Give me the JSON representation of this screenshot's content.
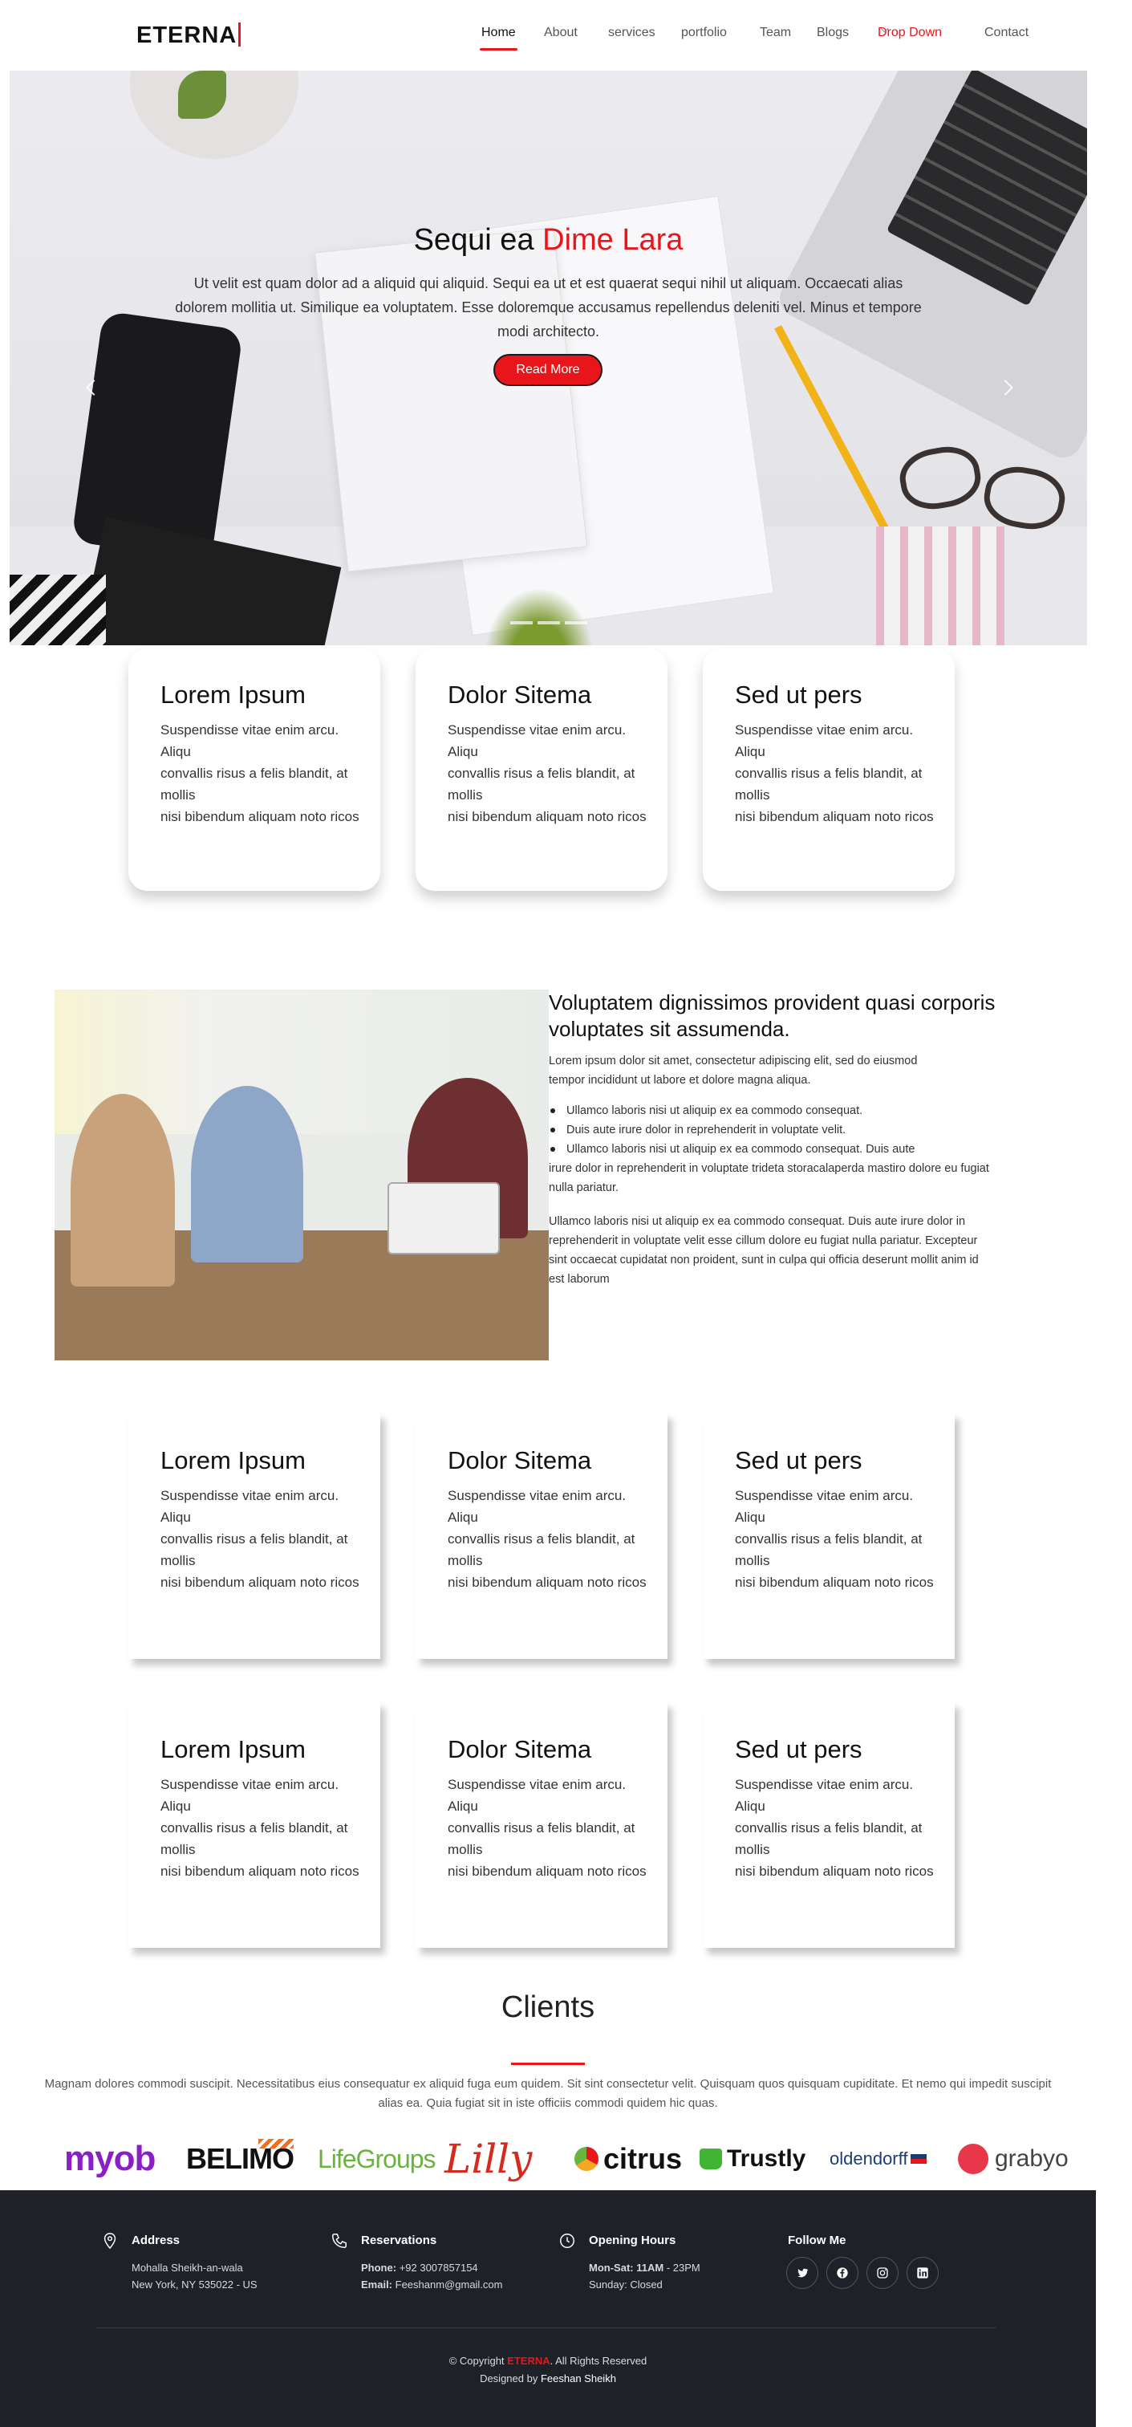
{
  "brand": {
    "name": "ETERNA"
  },
  "nav": {
    "items": [
      "Home",
      "About",
      "services",
      "portfolio",
      "Team",
      "Blogs",
      "Drop Down",
      "Contact"
    ],
    "active": "Home"
  },
  "hero": {
    "title_main": "Sequi ea",
    "title_accent": "Dime Lara",
    "text": "Ut velit est quam dolor ad a aliquid qui aliquid. Sequi ea ut et est quaerat sequi nihil ut aliquam. Occaecati alias dolorem mollitia ut. Similique ea voluptatem. Esse doloremque accusamus repellendus deleniti vel. Minus et tempore modi architecto.",
    "button": "Read More"
  },
  "cards_top": [
    {
      "title": "Lorem Ipsum",
      "line1": "Suspendisse vitae enim arcu. Aliqu",
      "line2": "convallis risus a felis blandit, at mollis",
      "line3": "nisi bibendum aliquam noto ricos"
    },
    {
      "title": "Dolor Sitema",
      "line1": "Suspendisse vitae enim arcu. Aliqu",
      "line2": "convallis risus a felis blandit, at mollis",
      "line3": "nisi bibendum aliquam noto ricos"
    },
    {
      "title": "Sed ut pers",
      "line1": "Suspendisse vitae enim arcu. Aliqu",
      "line2": "convallis risus a felis blandit, at mollis",
      "line3": "nisi bibendum aliquam noto ricos"
    }
  ],
  "about": {
    "title": "Voluptatem dignissimos provident quasi corporis voluptates sit assumenda.",
    "intro_1": "Lorem ipsum dolor sit amet, consectetur adipiscing elit, sed do eiusmod",
    "intro_2": "tempor incididunt ut labore et dolore magna aliqua.",
    "bullet_1": "Ullamco laboris nisi ut aliquip ex ea commodo consequat.",
    "bullet_2": "Duis aute irure dolor in reprehenderit in voluptate velit.",
    "bullet_3": "Ullamco laboris nisi ut aliquip ex ea commodo consequat. Duis aute",
    "bullet_3b": "irure dolor in reprehenderit in voluptate trideta storacalaperda mastiro dolore eu fugiat",
    "bullet_3c": "nulla pariatur.",
    "outro_1": "Ullamco laboris nisi ut aliquip ex ea commodo consequat. Duis aute irure dolor in",
    "outro_2": "reprehenderit in voluptate velit esse cillum dolore eu fugiat nulla pariatur. Excepteur",
    "outro_3": "sint occaecat cupidatat non proident, sunt in culpa qui officia deserunt mollit anim id",
    "outro_4": "est laborum"
  },
  "cards_grid": [
    {
      "title": "Lorem Ipsum",
      "line1": "Suspendisse vitae enim arcu. Aliqu",
      "line2": "convallis risus a felis blandit, at mollis",
      "line3": "nisi bibendum aliquam noto ricos"
    },
    {
      "title": "Dolor Sitema",
      "line1": "Suspendisse vitae enim arcu. Aliqu",
      "line2": "convallis risus a felis blandit, at mollis",
      "line3": "nisi bibendum aliquam noto ricos"
    },
    {
      "title": "Sed ut pers",
      "line1": "Suspendisse vitae enim arcu. Aliqu",
      "line2": "convallis risus a felis blandit, at mollis",
      "line3": "nisi bibendum aliquam noto ricos"
    },
    {
      "title": "Lorem Ipsum",
      "line1": "Suspendisse vitae enim arcu. Aliqu",
      "line2": "convallis risus a felis blandit, at mollis",
      "line3": "nisi bibendum aliquam noto ricos"
    },
    {
      "title": "Dolor Sitema",
      "line1": "Suspendisse vitae enim arcu. Aliqu",
      "line2": "convallis risus a felis blandit, at mollis",
      "line3": "nisi bibendum aliquam noto ricos"
    },
    {
      "title": "Sed ut pers",
      "line1": "Suspendisse vitae enim arcu. Aliqu",
      "line2": "convallis risus a felis blandit, at mollis",
      "line3": "nisi bibendum aliquam noto ricos"
    }
  ],
  "clients": {
    "title": "Clients",
    "text_1": "Magnam dolores commodi suscipit. Necessitatibus eius consequatur ex aliquid fuga eum quidem. Sit sint consectetur velit. Quisquam quos quisquam cupiditate. Et nemo qui impedit suscipit",
    "text_2": "alias ea. Quia fugiat sit in iste officiis commodi quidem hic quas.",
    "logos": [
      "myob",
      "BELIMO",
      "LifeGroups",
      "Lilly",
      "citrus",
      "Trustly",
      "oldendorff",
      "grabyo"
    ]
  },
  "footer": {
    "address": {
      "title": "Address",
      "line1": "Mohalla Sheikh-an-wala",
      "line2": "New York, NY 535022 - US"
    },
    "reservations": {
      "title": "Reservations",
      "phone_label": "Phone:",
      "phone": "+92 3007857154",
      "email_label": "Email:",
      "email": "Feeshanm@gmail.com"
    },
    "hours": {
      "title": "Opening Hours",
      "days_label": "Mon-Sat:",
      "days_value": "11AM",
      "days_rest": "- 23PM",
      "sunday": "Sunday: Closed"
    },
    "follow": {
      "title": "Follow Me"
    },
    "copyright_pre": "© Copyright",
    "copyright_brand": "ETERNA",
    "copyright_post": ". All Rights Reserved",
    "designed_pre": "Designed by",
    "designed_name": "Feeshan Sheikh"
  },
  "colors": {
    "accent": "#e8161b",
    "footer_bg": "#1f2128"
  }
}
